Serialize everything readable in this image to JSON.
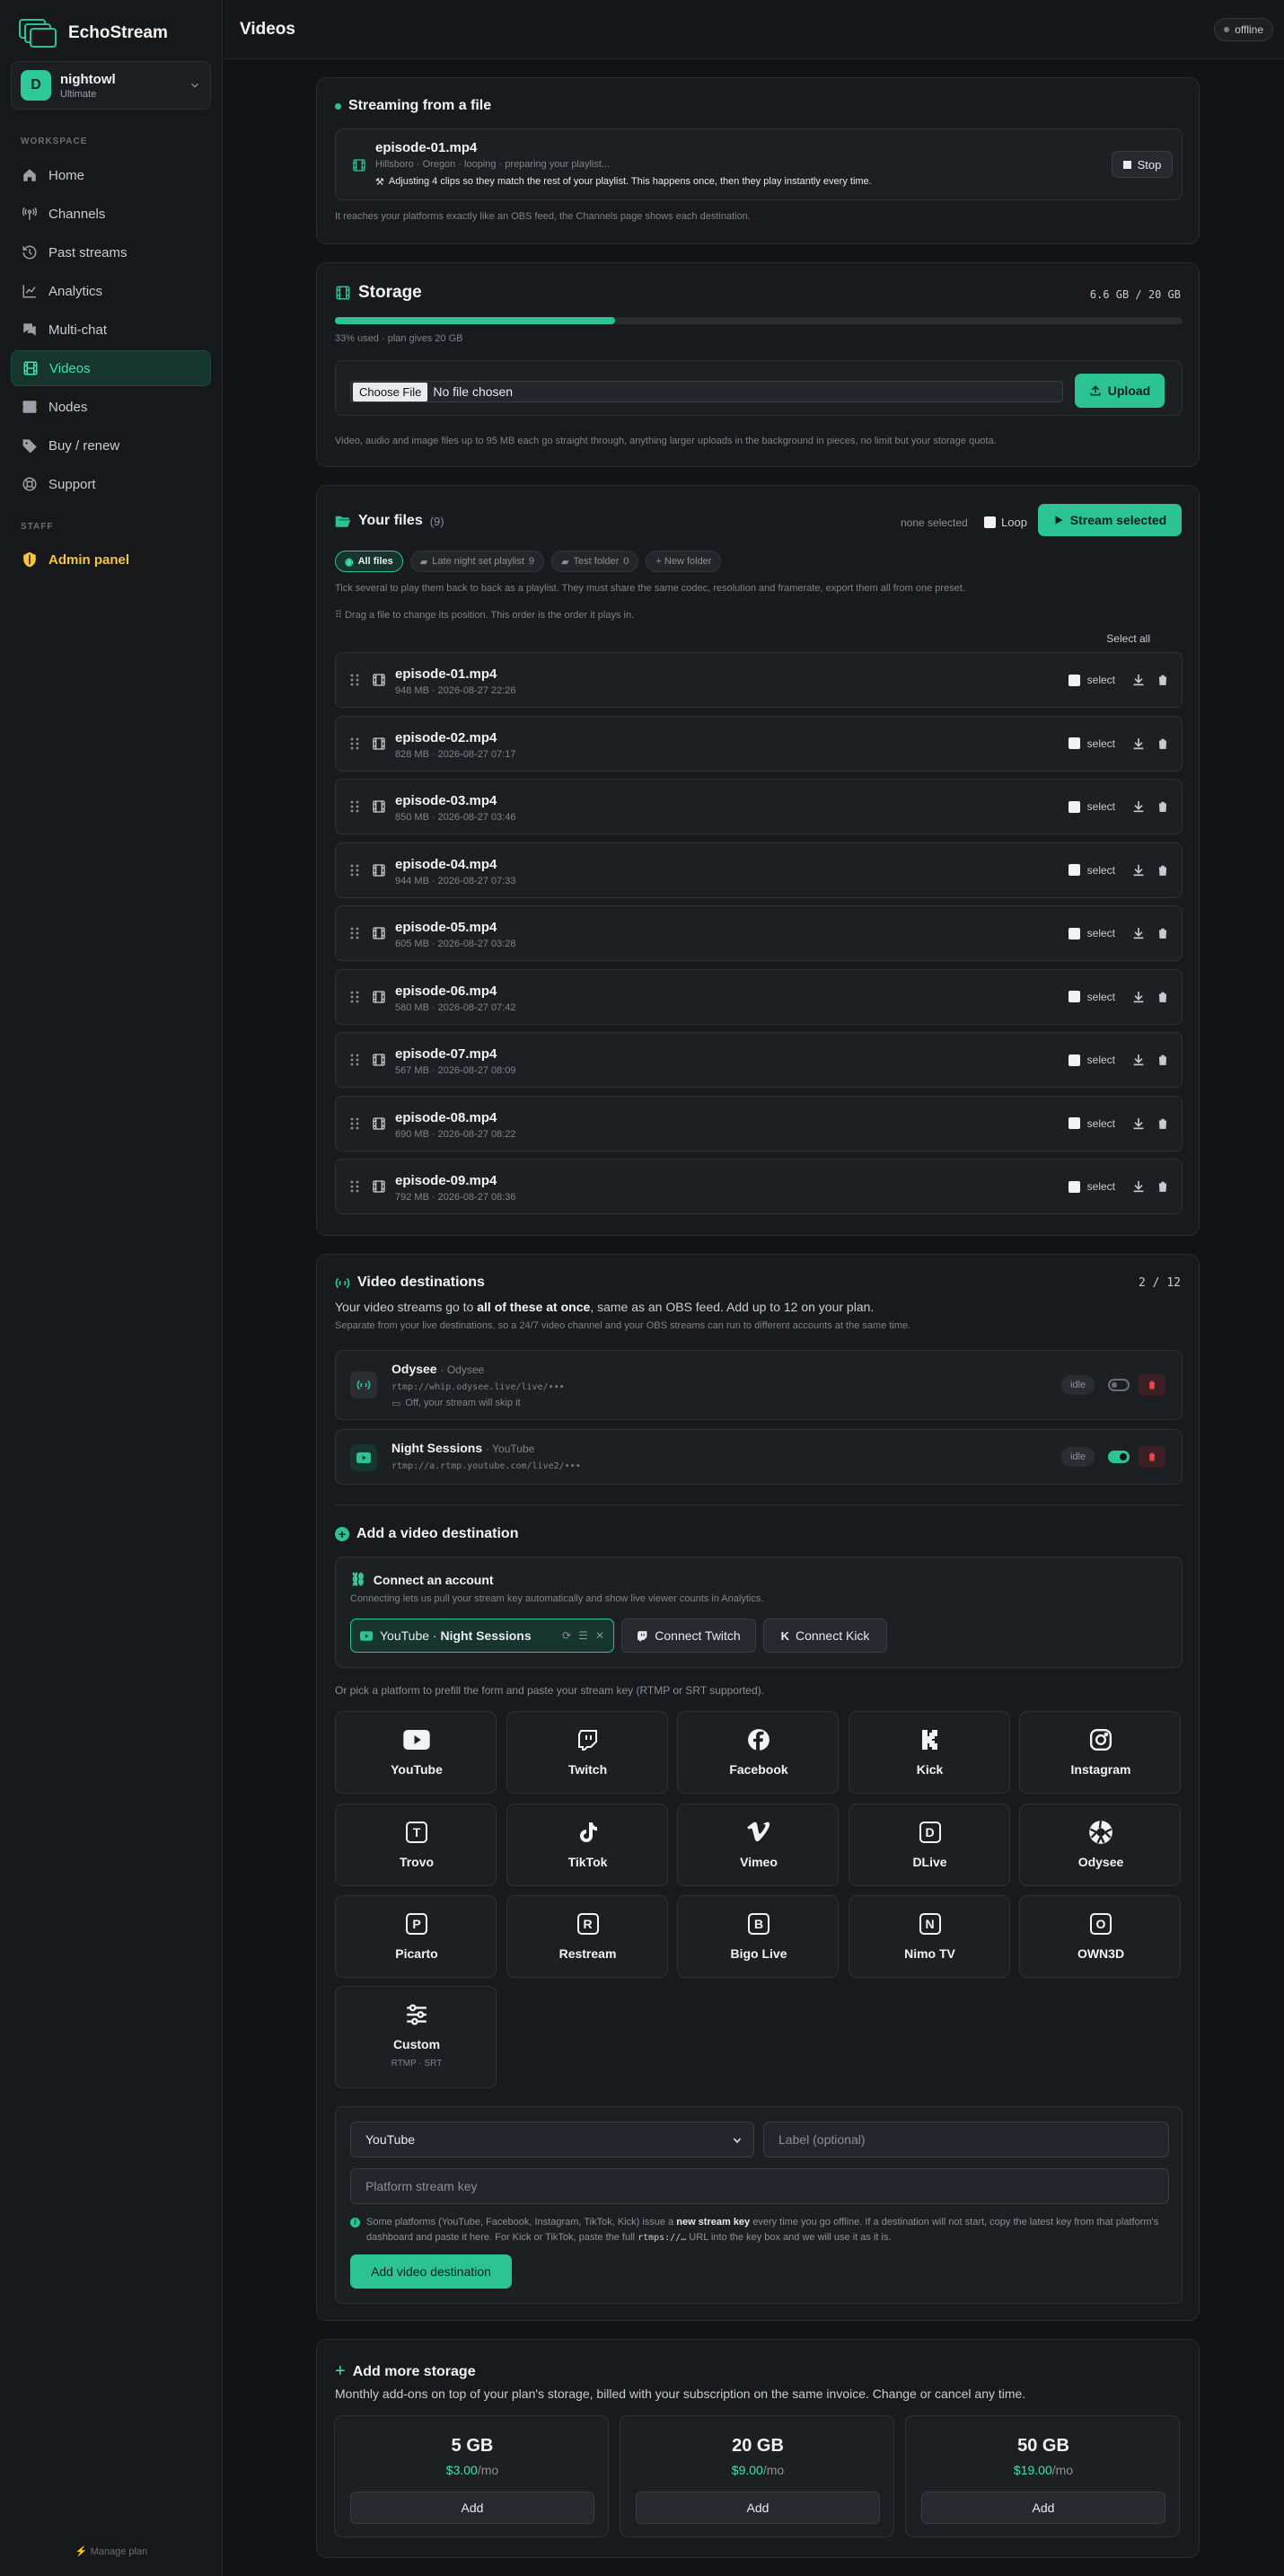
{
  "app": {
    "name": "EchoStream"
  },
  "account": {
    "initial": "D",
    "name": "nightowl",
    "plan": "Ultimate"
  },
  "sidebar": {
    "workspace_label": "WORKSPACE",
    "staff_label": "STAFF",
    "manage_plan": "⚡ Manage plan",
    "items": [
      {
        "label": "Home",
        "icon": "home-icon"
      },
      {
        "label": "Channels",
        "icon": "antenna-icon"
      },
      {
        "label": "Past streams",
        "icon": "history-icon"
      },
      {
        "label": "Analytics",
        "icon": "chart-icon"
      },
      {
        "label": "Multi-chat",
        "icon": "chat-icon"
      },
      {
        "label": "Videos",
        "icon": "film-icon",
        "active": true
      },
      {
        "label": "Nodes",
        "icon": "server-icon"
      },
      {
        "label": "Buy / renew",
        "icon": "tag-icon"
      },
      {
        "label": "Support",
        "icon": "lifebuoy-icon"
      }
    ],
    "admin": {
      "label": "Admin panel",
      "icon": "shield-icon"
    }
  },
  "header": {
    "title": "Videos",
    "status": "offline"
  },
  "streaming": {
    "title": "Streaming from a file",
    "file": "episode-01.mp4",
    "meta": "Hillsboro · Oregon · looping · preparing your playlist...",
    "note": "Adjusting 4 clips so they match the rest of your playlist. This happens once, then they play instantly every time.",
    "stop": "Stop",
    "footer": "It reaches your platforms exactly like an OBS feed, the Channels page shows each destination."
  },
  "storage": {
    "title": "Storage",
    "usage": "6.6 GB / 20 GB",
    "fraction": 0.33,
    "used_text": "33% used · plan gives 20 GB",
    "file_button": "Choose File",
    "file_status": "No file chosen",
    "upload": "Upload",
    "note": "Video, audio and image files up to 95 MB each go straight through, anything larger uploads in the background in pieces, no limit but your storage quota."
  },
  "files": {
    "title": "Your files",
    "count": "(9)",
    "none_selected": "none selected",
    "loop": "Loop",
    "stream_selected": "Stream selected",
    "folders": [
      {
        "label": "All files",
        "active": true
      },
      {
        "label": "Late night set playlist",
        "count": "9"
      },
      {
        "label": "Test folder",
        "count": "0"
      },
      {
        "label": "+ New folder"
      }
    ],
    "hint1": "Tick several to play them back to back as a playlist. They must share the same codec, resolution and framerate, export them all from one preset.",
    "hint2": "⠿ Drag a file to change its position. This order is the order it plays in.",
    "select_all": "Select all",
    "select_label": "select",
    "rows": [
      {
        "name": "episode-01.mp4",
        "meta": "948 MB · 2026-08-27 22:26"
      },
      {
        "name": "episode-02.mp4",
        "meta": "828 MB · 2026-08-27 07:17"
      },
      {
        "name": "episode-03.mp4",
        "meta": "850 MB · 2026-08-27 03:46"
      },
      {
        "name": "episode-04.mp4",
        "meta": "944 MB · 2026-08-27 07:33"
      },
      {
        "name": "episode-05.mp4",
        "meta": "605 MB · 2026-08-27 03:28"
      },
      {
        "name": "episode-06.mp4",
        "meta": "580 MB · 2026-08-27 07:42"
      },
      {
        "name": "episode-07.mp4",
        "meta": "567 MB · 2026-08-27 08:09"
      },
      {
        "name": "episode-08.mp4",
        "meta": "690 MB · 2026-08-27 08:22"
      },
      {
        "name": "episode-09.mp4",
        "meta": "792 MB · 2026-08-27 08:36"
      }
    ]
  },
  "destinations": {
    "title": "Video destinations",
    "count": "2 / 12",
    "desc_a": "Your video streams go to ",
    "desc_b": "all of these at once",
    "desc_c": ", same as an OBS feed. Add up to 12 on your plan.",
    "desc2": "Separate from your live destinations, so a 24/7 video channel and your OBS streams can run to different accounts at the same time.",
    "items": [
      {
        "name": "Odysee",
        "platform": "· Odysee",
        "url": "rtmp://whip.odysee.live/live/•••",
        "note": "Off, your stream will skip it",
        "status": "idle",
        "enabled": false
      },
      {
        "name": "Night Sessions",
        "platform": "· YouTube",
        "url": "rtmp://a.rtmp.youtube.com/live2/•••",
        "status": "idle",
        "enabled": true
      }
    ]
  },
  "add_dest": {
    "title": "Add a video destination",
    "connect_title": "Connect an account",
    "connect_desc": "Connecting lets us pull your stream key automatically and show live viewer counts in Analytics.",
    "connected_a": "YouTube · ",
    "connected_b": "Night Sessions",
    "connect_twitch": "Connect Twitch",
    "connect_kick": "Connect Kick",
    "pick_hint": "Or pick a platform to prefill the form and paste your stream key (RTMP or SRT supported).",
    "platforms": [
      {
        "name": "YouTube",
        "icon": "youtube-icon"
      },
      {
        "name": "Twitch",
        "icon": "twitch-icon"
      },
      {
        "name": "Facebook",
        "icon": "facebook-icon"
      },
      {
        "name": "Kick",
        "icon": "kick-icon"
      },
      {
        "name": "Instagram",
        "icon": "instagram-icon"
      },
      {
        "name": "Trovo",
        "letter": "T"
      },
      {
        "name": "TikTok",
        "icon": "tiktok-icon"
      },
      {
        "name": "Vimeo",
        "icon": "vimeo-icon"
      },
      {
        "name": "DLive",
        "letter": "D"
      },
      {
        "name": "Odysee",
        "icon": "odysee-icon"
      },
      {
        "name": "Picarto",
        "letter": "P"
      },
      {
        "name": "Restream",
        "letter": "R"
      },
      {
        "name": "Bigo Live",
        "letter": "B"
      },
      {
        "name": "Nimo TV",
        "letter": "N"
      },
      {
        "name": "OWN3D",
        "letter": "O"
      }
    ],
    "custom": {
      "name": "Custom",
      "sub": "RTMP · SRT"
    },
    "form": {
      "platform": "YouTube",
      "label_placeholder": "Label (optional)",
      "key_placeholder": "Platform stream key",
      "note_a": "Some platforms (YouTube, Facebook, Instagram, TikTok, Kick) issue a ",
      "note_b": "new stream key",
      "note_c": " every time you go offline. If a destination will not start, copy the latest key from that platform's dashboard and paste it here. For Kick or TikTok, paste the full ",
      "note_d": "rtmps://…",
      "note_e": " URL into the key box and we will use it as it is.",
      "submit": "Add video destination"
    }
  },
  "more_storage": {
    "title": "Add more storage",
    "desc": "Monthly add-ons on top of your plan's storage, billed with your subscription on the same invoice. Change or cancel any time.",
    "tiers": [
      {
        "size": "5 GB",
        "price": "$3.00",
        "per": "/mo",
        "add": "Add"
      },
      {
        "size": "20 GB",
        "price": "$9.00",
        "per": "/mo",
        "add": "Add"
      },
      {
        "size": "50 GB",
        "price": "$19.00",
        "per": "/mo",
        "add": "Add"
      }
    ]
  },
  "colors": {
    "accent": "#2bc394",
    "bg": "#111315",
    "card": "#181a1d",
    "admin": "#f5c542",
    "danger": "#e5484d"
  }
}
